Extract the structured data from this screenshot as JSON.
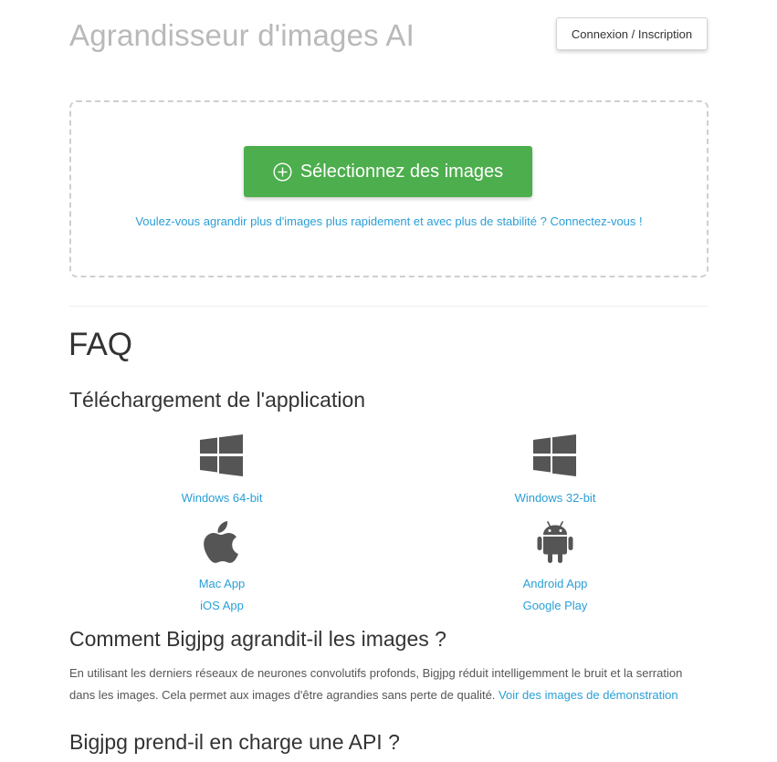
{
  "header": {
    "title": "Agrandisseur d'images AI",
    "login_label": "Connexion / Inscription"
  },
  "upload": {
    "select_label": "Sélectionnez des images",
    "login_hint": "Voulez-vous agrandir plus d'images plus rapidement et avec plus de stabilité ? Connectez-vous !"
  },
  "faq": {
    "title": "FAQ",
    "download": {
      "heading": "Téléchargement de l'application",
      "windows64": "Windows 64-bit",
      "windows32": "Windows 32-bit",
      "mac": "Mac App",
      "ios": "iOS App",
      "android": "Android App",
      "google_play": "Google Play"
    },
    "how": {
      "heading": "Comment Bigjpg agrandit-il les images ?",
      "text": "En utilisant les derniers réseaux de neurones convolutifs profonds, Bigjpg réduit intelligemment le bruit et la serration dans les images. Cela permet aux images d'être agrandies sans perte de qualité.",
      "link": "Voir des images de démonstration"
    },
    "api": {
      "heading": "Bigjpg prend-il en charge une API ?"
    }
  },
  "colors": {
    "accent_green": "#4cae4c",
    "link_blue": "#2a9fd6",
    "icon_gray": "#555555"
  }
}
